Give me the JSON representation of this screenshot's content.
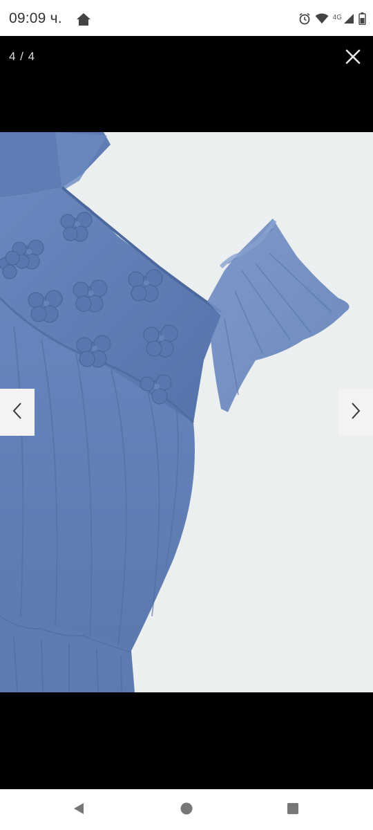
{
  "status_bar": {
    "time": "09:09 ч.",
    "network": "4G",
    "icons": [
      "home-icon",
      "alarm-icon",
      "wifi-icon",
      "signal-icon",
      "battery-icon"
    ]
  },
  "viewer": {
    "counter": "4 / 4",
    "close_icon": "close-icon",
    "prev_icon": "chevron-left-icon",
    "next_icon": "chevron-right-icon",
    "image_subject": "blue tulle dress with 3D flower appliqués",
    "colors": {
      "dress": "#5f7fb7",
      "background": "#eceff0"
    }
  },
  "system_nav": {
    "icons": [
      "back-icon",
      "home-circle-icon",
      "recents-icon"
    ]
  }
}
